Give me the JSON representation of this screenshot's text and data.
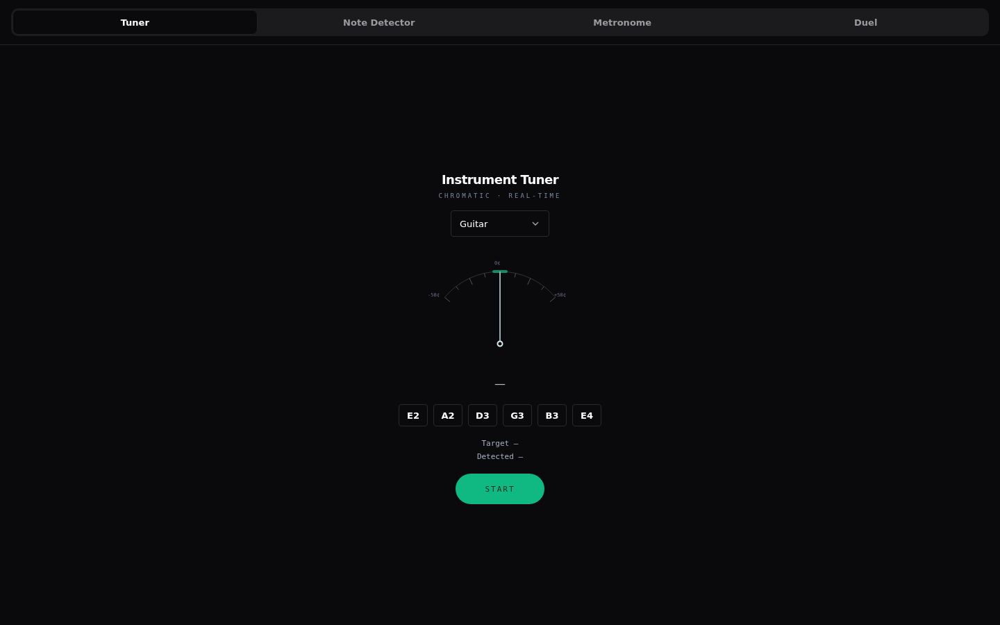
{
  "tabs": [
    {
      "label": "Tuner",
      "selected": true
    },
    {
      "label": "Note Detector",
      "selected": false
    },
    {
      "label": "Metronome",
      "selected": false
    },
    {
      "label": "Duel",
      "selected": false
    }
  ],
  "tuner": {
    "title": "Instrument Tuner",
    "subtitle": "CHROMATIC · REAL-TIME",
    "instrument": "Guitar",
    "gauge": {
      "min_label": "-50¢",
      "center_label": "0¢",
      "max_label": "+50¢",
      "level": 0.5
    },
    "note": "—",
    "strings": [
      {
        "label": "E2",
        "selected": false
      },
      {
        "label": "A2",
        "selected": false
      },
      {
        "label": "D3",
        "selected": false
      },
      {
        "label": "G3",
        "selected": false
      },
      {
        "label": "B3",
        "selected": false
      },
      {
        "label": "E4",
        "selected": false
      }
    ],
    "target": "Target —",
    "detected": "Detected —",
    "start_button": "START"
  }
}
